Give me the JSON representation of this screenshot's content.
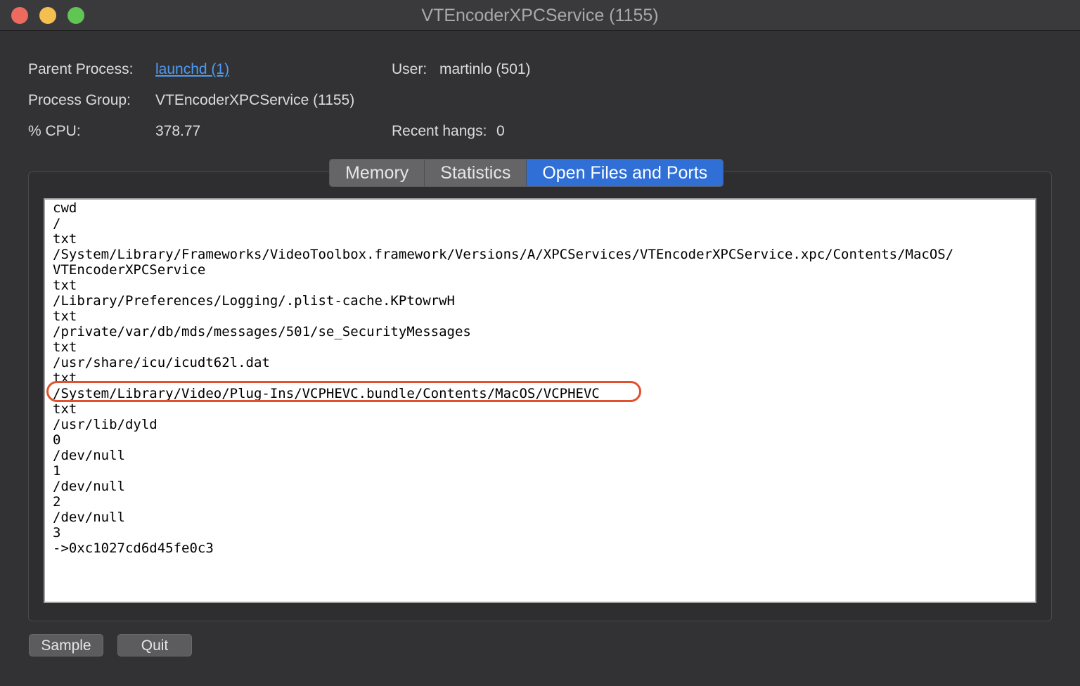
{
  "window": {
    "title": "VTEncoderXPCService (1155)"
  },
  "info": {
    "parent_process_label": "Parent Process:",
    "parent_process_value": "launchd (1)",
    "user_label": "User:",
    "user_value": "martinlo (501)",
    "process_group_label": "Process Group:",
    "process_group_value": "VTEncoderXPCService (1155)",
    "cpu_label": "% CPU:",
    "cpu_value": "378.77",
    "recent_hangs_label": "Recent hangs:",
    "recent_hangs_value": "0"
  },
  "tabs": [
    {
      "label": "Memory",
      "active": false
    },
    {
      "label": "Statistics",
      "active": false
    },
    {
      "label": "Open Files and Ports",
      "active": true
    }
  ],
  "files": [
    "cwd",
    "/",
    "txt",
    "/System/Library/Frameworks/VideoToolbox.framework/Versions/A/XPCServices/VTEncoderXPCService.xpc/Contents/MacOS/",
    "VTEncoderXPCService",
    "txt",
    "/Library/Preferences/Logging/.plist-cache.KPtowrwH",
    "txt",
    "/private/var/db/mds/messages/501/se_SecurityMessages",
    "txt",
    "/usr/share/icu/icudt62l.dat",
    "txt",
    "/System/Library/Video/Plug-Ins/VCPHEVC.bundle/Contents/MacOS/VCPHEVC",
    "txt",
    "/usr/lib/dyld",
    "0",
    "/dev/null",
    "1",
    "/dev/null",
    "2",
    "/dev/null",
    "3",
    "->0xc1027cd6d45fe0c3"
  ],
  "buttons": {
    "sample_label": "Sample",
    "quit_label": "Quit"
  },
  "colors": {
    "accent_tab": "#2f6fd6",
    "highlight_ring": "#e2502d",
    "link": "#4d9cf6"
  }
}
